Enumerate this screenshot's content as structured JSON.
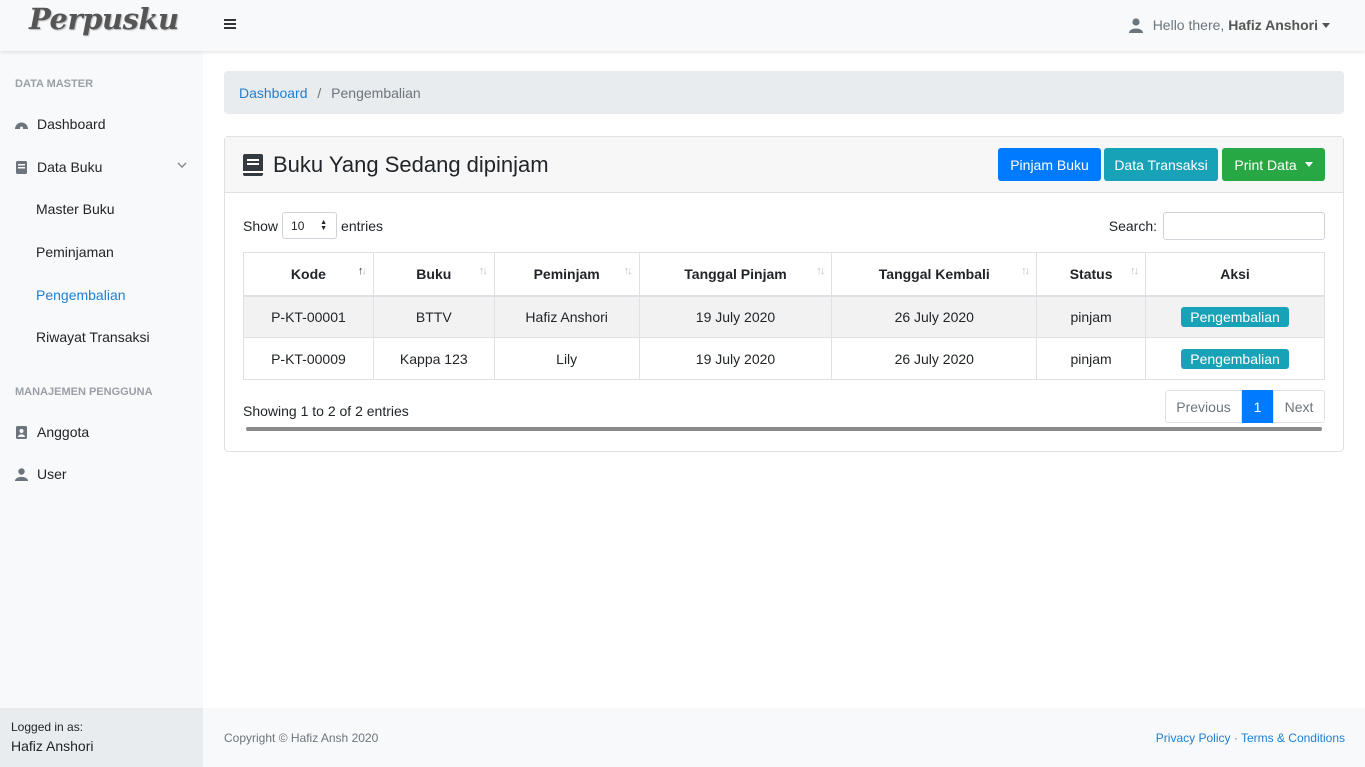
{
  "brand": "Perpusku",
  "user": {
    "greeting": "Hello there,",
    "name": "Hafiz Anshori"
  },
  "sidebar": {
    "heading_master": "DATA MASTER",
    "dashboard": "Dashboard",
    "data_buku": "Data Buku",
    "sub_items": [
      "Master Buku",
      "Peminjaman",
      "Pengembalian",
      "Riwayat Transaksi"
    ],
    "heading_users": "MANAJEMEN PENGGUNA",
    "anggota": "Anggota",
    "user": "User",
    "logged_in_label": "Logged in as:",
    "logged_in_name": "Hafiz Anshori"
  },
  "breadcrumb": {
    "home": "Dashboard",
    "sep": "/",
    "current": "Pengembalian"
  },
  "card": {
    "title": "Buku Yang Sedang dipinjam",
    "btn_pinjam": "Pinjam Buku",
    "btn_transaksi": "Data Transaksi",
    "btn_print": "Print Data"
  },
  "table_controls": {
    "show": "Show",
    "entries_value": "10",
    "entries": "entries",
    "search_label": "Search:"
  },
  "table": {
    "headers": [
      "Kode",
      "Buku",
      "Peminjam",
      "Tanggal Pinjam",
      "Tanggal Kembali",
      "Status",
      "Aksi"
    ],
    "rows": [
      [
        "P-KT-00001",
        "BTTV",
        "Hafiz Anshori",
        "19 July 2020",
        "26 July 2020",
        "pinjam",
        "Pengembalian"
      ],
      [
        "P-KT-00009",
        "Kappa 123",
        "Lily",
        "19 July 2020",
        "26 July 2020",
        "pinjam",
        "Pengembalian"
      ]
    ]
  },
  "pagination": {
    "info": "Showing 1 to 2 of 2 entries",
    "previous": "Previous",
    "page": "1",
    "next": "Next"
  },
  "footer": {
    "copyright": "Copyright © Hafiz Ansh 2020",
    "privacy": "Privacy Policy",
    "dot": "·",
    "terms": "Terms & Conditions"
  },
  "colors": {
    "primary": "#007bff",
    "info": "#17a2b8",
    "success": "#28a745",
    "link": "#1f7fd1"
  }
}
